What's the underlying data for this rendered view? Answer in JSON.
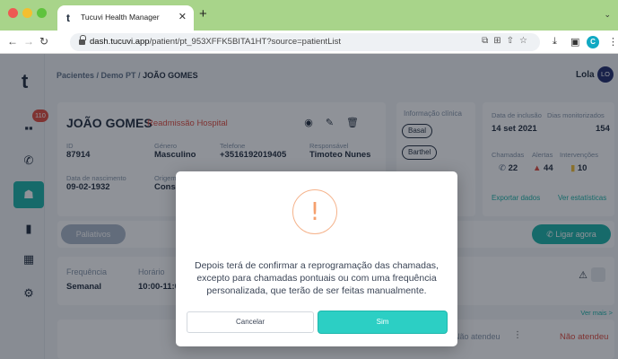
{
  "browser": {
    "tab_title": "Tucuvi Health Manager",
    "tab_favicon": "t",
    "url_host": "dash.tucuvi.app",
    "url_path": "/patient/pt_953XFFK5BITA1HT?source=patientList",
    "profile_initial": "C"
  },
  "sidebar": {
    "logo": "t",
    "badge": "110"
  },
  "header": {
    "breadcrumb_parent": "Pacientes / Demo PT /",
    "breadcrumb_current": "JOÃO GOMES",
    "user_name": "Lola",
    "user_initials": "LO"
  },
  "patient": {
    "name": "JOÃO GOMES",
    "readmission": "Readmissão Hospital",
    "id_label": "ID",
    "id_value": "87914",
    "gender_label": "Género",
    "gender_value": "Masculino",
    "phone_label": "Telefone",
    "phone_value": "+3516192019405",
    "responsible_label": "Responsável",
    "responsible_value": "Timoteo Nunes",
    "birth_label": "Data de nascimento",
    "birth_value": "09-02-1932",
    "origin_label": "Origem",
    "origin_value": "Consu"
  },
  "clinic": {
    "title": "Informação clínica",
    "tags": [
      "Basal",
      "Barthel"
    ]
  },
  "stats": {
    "inclusion_label": "Data de inclusão",
    "inclusion_value": "14 set 2021",
    "days_label": "Dias monitorizados",
    "days_value": "154",
    "calls_label": "Chamadas",
    "calls_value": "22",
    "alerts_label": "Alertas",
    "alerts_value": "44",
    "interventions_label": "Intervenções",
    "interventions_value": "10",
    "export_link": "Exportar dados",
    "stats_link": "Ver estatísticas"
  },
  "tagbar": {
    "palliative": "Paliativos",
    "call_button": "Ligar agora"
  },
  "schedule": {
    "freq_label": "Frequência",
    "freq_value": "Semanal",
    "time_label": "Horário",
    "time_value": "10:00-11:0"
  },
  "calls": {
    "see_more": "Ver mais >",
    "status_1": "Não atendeu",
    "status_2": "Não atendeu"
  },
  "modal": {
    "icon": "!",
    "message": "Depois terá de confirmar a reprogramação das chamadas, excepto para chamadas pontuais ou com uma frequência personalizada, que terão de ser feitas manualmente.",
    "cancel_label": "Cancelar",
    "confirm_label": "Sim"
  },
  "colors": {
    "accent": "#2ccfc4",
    "danger": "#e04a3c",
    "warning": "#f5a06d",
    "chrome": "#a8d48a"
  }
}
